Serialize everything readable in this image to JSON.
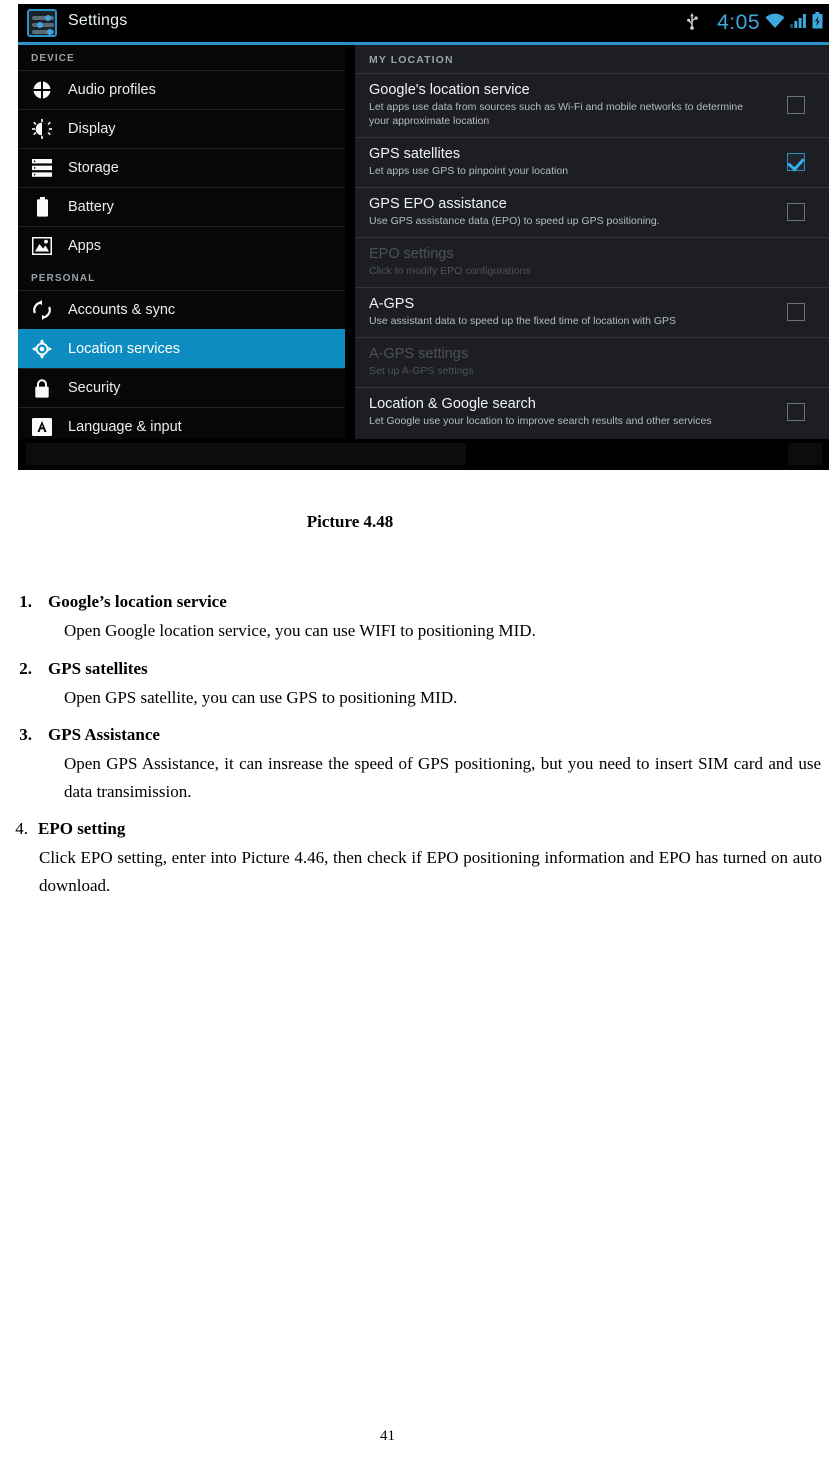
{
  "screenshot": {
    "status_bar": {
      "app_title": "Settings",
      "app_icon": "settings-sliders-icon",
      "usb_icon": "usb-icon",
      "clock": "4:05",
      "wifi_icon": "wifi-icon",
      "signal_icon": "signal-bars-icon",
      "battery_icon": "battery-charging-icon",
      "accent_color": "#2a93c9"
    },
    "sidebar": {
      "groups": [
        {
          "header": "DEVICE",
          "items": [
            {
              "label": "Audio profiles",
              "icon": "audio-profiles-icon",
              "selected": false
            },
            {
              "label": "Display",
              "icon": "display-brightness-icon",
              "selected": false
            },
            {
              "label": "Storage",
              "icon": "storage-icon",
              "selected": false
            },
            {
              "label": "Battery",
              "icon": "battery-icon",
              "selected": false
            },
            {
              "label": "Apps",
              "icon": "apps-image-icon",
              "selected": false
            }
          ]
        },
        {
          "header": "PERSONAL",
          "items": [
            {
              "label": "Accounts & sync",
              "icon": "sync-icon",
              "selected": false
            },
            {
              "label": "Location services",
              "icon": "location-target-icon",
              "selected": true
            },
            {
              "label": "Security",
              "icon": "lock-icon",
              "selected": false
            },
            {
              "label": "Language & input",
              "icon": "language-input-icon",
              "selected": false
            }
          ]
        }
      ],
      "selected_color": "#0c8cc0"
    },
    "detail": {
      "section_header": "MY LOCATION",
      "rows": [
        {
          "title": "Google's location service",
          "subtitle": "Let apps use data from sources such as Wi-Fi and mobile networks to determine your approximate location",
          "checked": false,
          "disabled": false
        },
        {
          "title": "GPS satellites",
          "subtitle": "Let apps use GPS to pinpoint your location",
          "checked": true,
          "disabled": false
        },
        {
          "title": "GPS EPO assistance",
          "subtitle": "Use GPS assistance data (EPO) to speed up GPS positioning.",
          "checked": false,
          "disabled": false
        },
        {
          "title": "EPO settings",
          "subtitle": "Click to modify EPO configurations",
          "checked": null,
          "disabled": true
        },
        {
          "title": "A-GPS",
          "subtitle": "Use assistant data to speed up the fixed time of location with GPS",
          "checked": false,
          "disabled": false
        },
        {
          "title": "A-GPS settings",
          "subtitle": "Set up A-GPS settings",
          "checked": null,
          "disabled": true
        },
        {
          "title": "Location & Google search",
          "subtitle": "Let Google use your location to improve search results and other services",
          "checked": false,
          "disabled": false
        }
      ]
    }
  },
  "document": {
    "caption": "Picture 4.48",
    "items": [
      {
        "number": "1.",
        "title": "Google’s location service",
        "body": "Open Google location service, you can use WIFI to positioning MID."
      },
      {
        "number": "2.",
        "title": "GPS satellites",
        "body": "Open GPS satellite, you can use GPS to positioning MID."
      },
      {
        "number": "3.",
        "title": "GPS Assistance",
        "body": "Open GPS Assistance, it can insrease the speed of GPS positioning, but you need to insert SIM card and use data transimission."
      },
      {
        "number": "4.",
        "title": "EPO setting",
        "body": "Click EPO setting, enter into Picture 4.46, then check if EPO positioning information and EPO has turned on auto download."
      }
    ],
    "page_number": "41"
  }
}
